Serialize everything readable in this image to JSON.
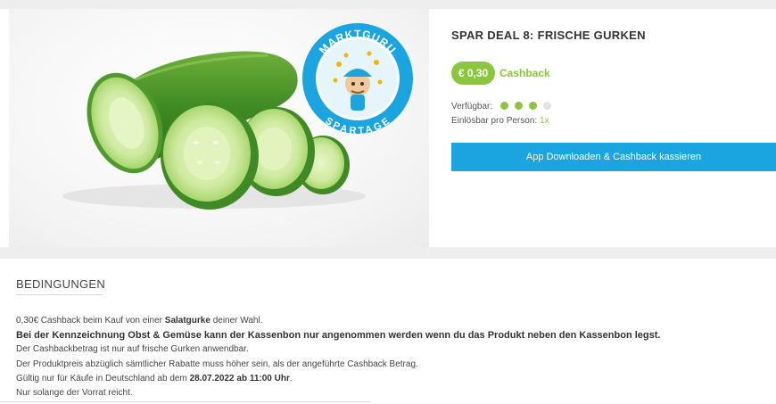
{
  "product": {
    "title": "SPAR DEAL 8: FRISCHE GURKEN",
    "price": "€ 0,30",
    "cashback_label": "Cashback",
    "availability_label": "Verfügbar:",
    "availability_level": 3,
    "availability_max": 4,
    "limit_label": "Einlösbar pro Person:",
    "limit_value": "1x",
    "cta_label": "App Downloaden & Cashback kassieren",
    "accent_color": "#8cc63f",
    "button_color": "#1aa5e1"
  },
  "badge": {
    "top_text": "MARKTGURU",
    "bottom_text": "SPARTAGE",
    "color": "#1aa5e1"
  },
  "conditions": {
    "heading": "BEDINGUNGEN",
    "line1_pre": "0,30€ Cashback beim Kauf von einer ",
    "line1_bold": "Salatgurke",
    "line1_post": " deiner Wahl.",
    "line2": "Bei der Kennzeichnung Obst & Gemüse kann der Kassenbon nur angenommen werden wenn du das Produkt neben den Kassenbon legst.",
    "line3": "Der Cashbackbetrag ist nur auf frische Gurken anwendbar.",
    "line4": "Der Produktpreis abzüglich sämtlicher Rabatte muss höher sein, als der angeführte Cashback Betrag.",
    "line5_pre": "Gültig nur für Käufe in Deutschland ab dem ",
    "line5_bold": "28.07.2022 ab 11:00 Uhr",
    "line5_post": ".",
    "line6": "Nur solange der Vorrat reicht."
  }
}
